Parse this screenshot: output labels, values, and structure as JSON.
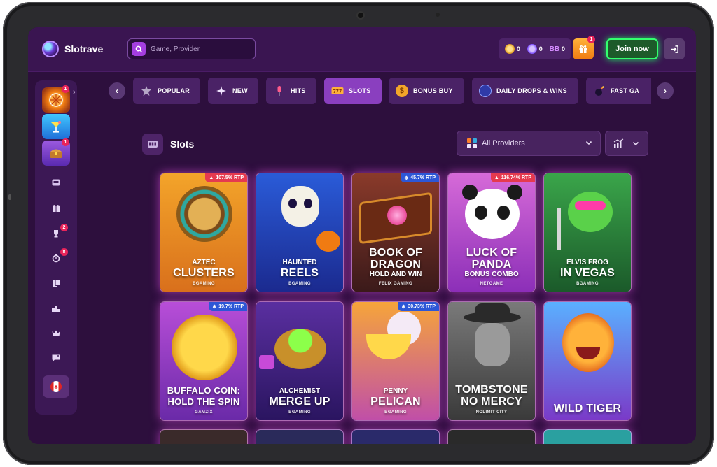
{
  "brand": {
    "name": "Slotrave"
  },
  "search": {
    "placeholder": "Game, Provider"
  },
  "wallet": [
    {
      "icon": "gold-coin-icon",
      "value": "0",
      "color": "#f2b233"
    },
    {
      "icon": "sweep-coin-icon",
      "value": "0",
      "color": "#8a5cff"
    },
    {
      "icon": "bb-icon",
      "label": "BB",
      "value": "0",
      "color": "#c06cff"
    }
  ],
  "header": {
    "gift_badge": "1",
    "join_label": "Join now"
  },
  "sidebar": {
    "games": [
      {
        "name": "sidebar-game-wheel",
        "badge": "1",
        "color": "#f07b12"
      },
      {
        "name": "sidebar-game-cocktail",
        "color": "#2fb3ff"
      },
      {
        "name": "sidebar-game-chest",
        "badge": "1",
        "color": "#7a3cc8"
      }
    ],
    "icons": [
      {
        "name": "slots-machine-icon"
      },
      {
        "name": "live-dealer-icon"
      },
      {
        "name": "trophy-icon",
        "badge": "2"
      },
      {
        "name": "stopwatch-icon",
        "badge": "8"
      },
      {
        "name": "cards-icon"
      },
      {
        "name": "leaderboard-icon"
      },
      {
        "name": "crown-icon"
      },
      {
        "name": "support-chat-icon"
      }
    ]
  },
  "categories": [
    {
      "label": "POPULAR",
      "icon": "star-icon"
    },
    {
      "label": "NEW",
      "icon": "sparkle-icon"
    },
    {
      "label": "HITS",
      "icon": "mic-icon"
    },
    {
      "label": "SLOTS",
      "icon": "slot-icon",
      "active": true
    },
    {
      "label": "BONUS BUY",
      "icon": "coin-icon"
    },
    {
      "label": "DAILY DROPS & WINS",
      "icon": "drops-icon"
    },
    {
      "label": "FAST GA",
      "icon": "bomb-icon"
    }
  ],
  "section": {
    "title": "Slots"
  },
  "filters": {
    "providers_label": "All Providers"
  },
  "games": [
    {
      "small": "AZTEC",
      "big": "CLUSTERS",
      "provider": "BGAMING",
      "rtp": "107.5% RTP",
      "rtp_type": "hot",
      "bg": [
        "#f3a42a",
        "#d9701c"
      ]
    },
    {
      "small": "HAUNTED",
      "big": "REELS",
      "provider": "BGAMING",
      "bg": [
        "#2a5bd8",
        "#1b2a8f"
      ]
    },
    {
      "big": "BOOK OF DRAGON",
      "small2": "HOLD AND WIN",
      "provider": "FELIX GAMING",
      "rtp": "45.7% RTP",
      "rtp_type": "cold",
      "bg": [
        "#8a3a2a",
        "#3b1a1a"
      ]
    },
    {
      "big": "LUCK OF PANDA",
      "small2": "BONUS COMBO",
      "provider": "NETGAME",
      "rtp": "116.74% RTP",
      "rtp_type": "hot",
      "bg": [
        "#d66ad8",
        "#8c2fb8"
      ]
    },
    {
      "small": "ELVIS FROG",
      "big": "IN VEGAS",
      "provider": "BGAMING",
      "bg": [
        "#3aa54a",
        "#1b5a2a"
      ]
    },
    {
      "big": "BUFFALO COIN: HOLD THE SPIN",
      "provider": "GAMZIX",
      "rtp": "19.7% RTP",
      "rtp_type": "cold",
      "bg": [
        "#b84ed8",
        "#6a2aa8"
      ]
    },
    {
      "small": "ALCHEMIST",
      "big": "MERGE UP",
      "provider": "BGAMING",
      "bg": [
        "#5a2fa0",
        "#2a1560"
      ]
    },
    {
      "small": "PENNY",
      "big": "PELICAN",
      "provider": "BGAMING",
      "rtp": "30.73% RTP",
      "rtp_type": "cold",
      "bg": [
        "#f6a53a",
        "#c04fa8"
      ]
    },
    {
      "big": "TOMBSTONE NO MERCY",
      "provider": "NOLIMIT CITY",
      "bg": [
        "#7a7a7a",
        "#3a3a3a"
      ]
    },
    {
      "big": "WILD TIGER",
      "bg": [
        "#5ab0ff",
        "#7a3ac8"
      ]
    }
  ]
}
